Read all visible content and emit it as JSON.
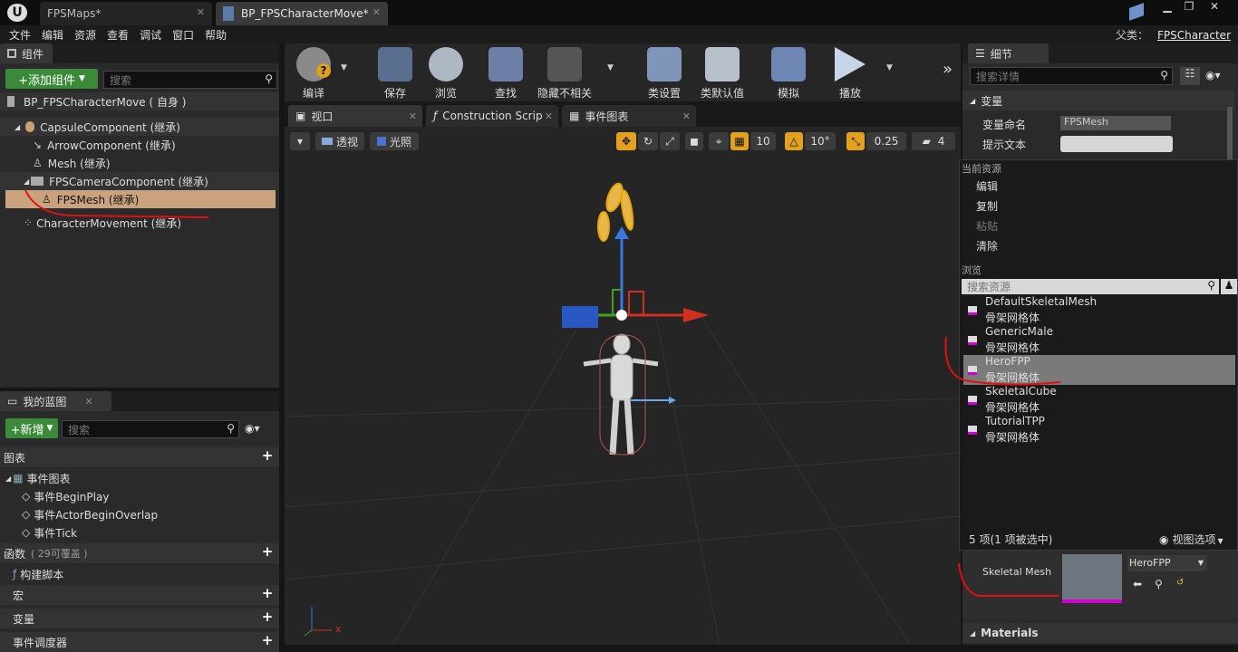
{
  "app": {
    "tabs": [
      "FPSMaps*",
      "BP_FPSCharacterMove*"
    ],
    "menu": [
      "文件",
      "编辑",
      "资源",
      "查看",
      "调试",
      "窗口",
      "帮助"
    ],
    "parent_label": "父类：",
    "parent_value": "FPSCharacter"
  },
  "components": {
    "tab": "组件",
    "add_button": "+添加组件",
    "search_placeholder": "搜索",
    "root": "BP_FPSCharacterMove ( 自身 )",
    "items": [
      "CapsuleComponent (继承)",
      "ArrowComponent (继承)",
      "Mesh (继承)",
      "FPSCameraComponent (继承)",
      "FPSMesh (继承)",
      "CharacterMovement (继承)"
    ]
  },
  "my_blueprint": {
    "tab": "我的蓝图",
    "add_button": "+新增",
    "search_placeholder": "搜索",
    "graphs": "图表",
    "event_graph": "事件图表",
    "events": [
      "事件BeginPlay",
      "事件ActorBeginOverlap",
      "事件Tick"
    ],
    "functions": "函数",
    "functions_count": "( 29可覆盖 )",
    "construct": "构建脚本",
    "macros": "宏",
    "variables": "变量",
    "dispatchers": "事件调度器"
  },
  "toolbar": [
    "编译",
    "保存",
    "浏览",
    "查找",
    "隐藏不相关",
    "类设置",
    "类默认值",
    "模拟",
    "播放"
  ],
  "editor_tabs": [
    "视口",
    "Construction Scrip",
    "事件图表"
  ],
  "viewport": {
    "perspective": "透视",
    "lit": "光照",
    "grid_snap": "10",
    "rot_snap": "10°",
    "scale_snap": "0.25",
    "cam_speed": "4",
    "axis_x": "x"
  },
  "details": {
    "tab": "细节",
    "search_placeholder": "搜索详情",
    "section_variables": "变量",
    "var_name_label": "变量命名",
    "var_name_value": "FPSMesh",
    "tooltip_label": "提示文本",
    "skeletal_mesh_label": "Skeletal Mesh",
    "mesh_value": "HeroFPP",
    "materials": "Materials"
  },
  "context_menu": {
    "current_asset": "当前资源",
    "actions": [
      "编辑",
      "复制",
      "粘贴",
      "清除"
    ],
    "browse": "浏览",
    "search_placeholder": "搜索资源",
    "assets": [
      {
        "name": "DefaultSkeletalMesh",
        "type": "骨架网格体"
      },
      {
        "name": "GenericMale",
        "type": "骨架网格体"
      },
      {
        "name": "HeroFPP",
        "type": "骨架网格体"
      },
      {
        "name": "SkeletalCube",
        "type": "骨架网格体"
      },
      {
        "name": "TutorialTPP",
        "type": "骨架网格体"
      }
    ],
    "count": "5 项(1 项被选中)",
    "view_options": "视图选项"
  }
}
